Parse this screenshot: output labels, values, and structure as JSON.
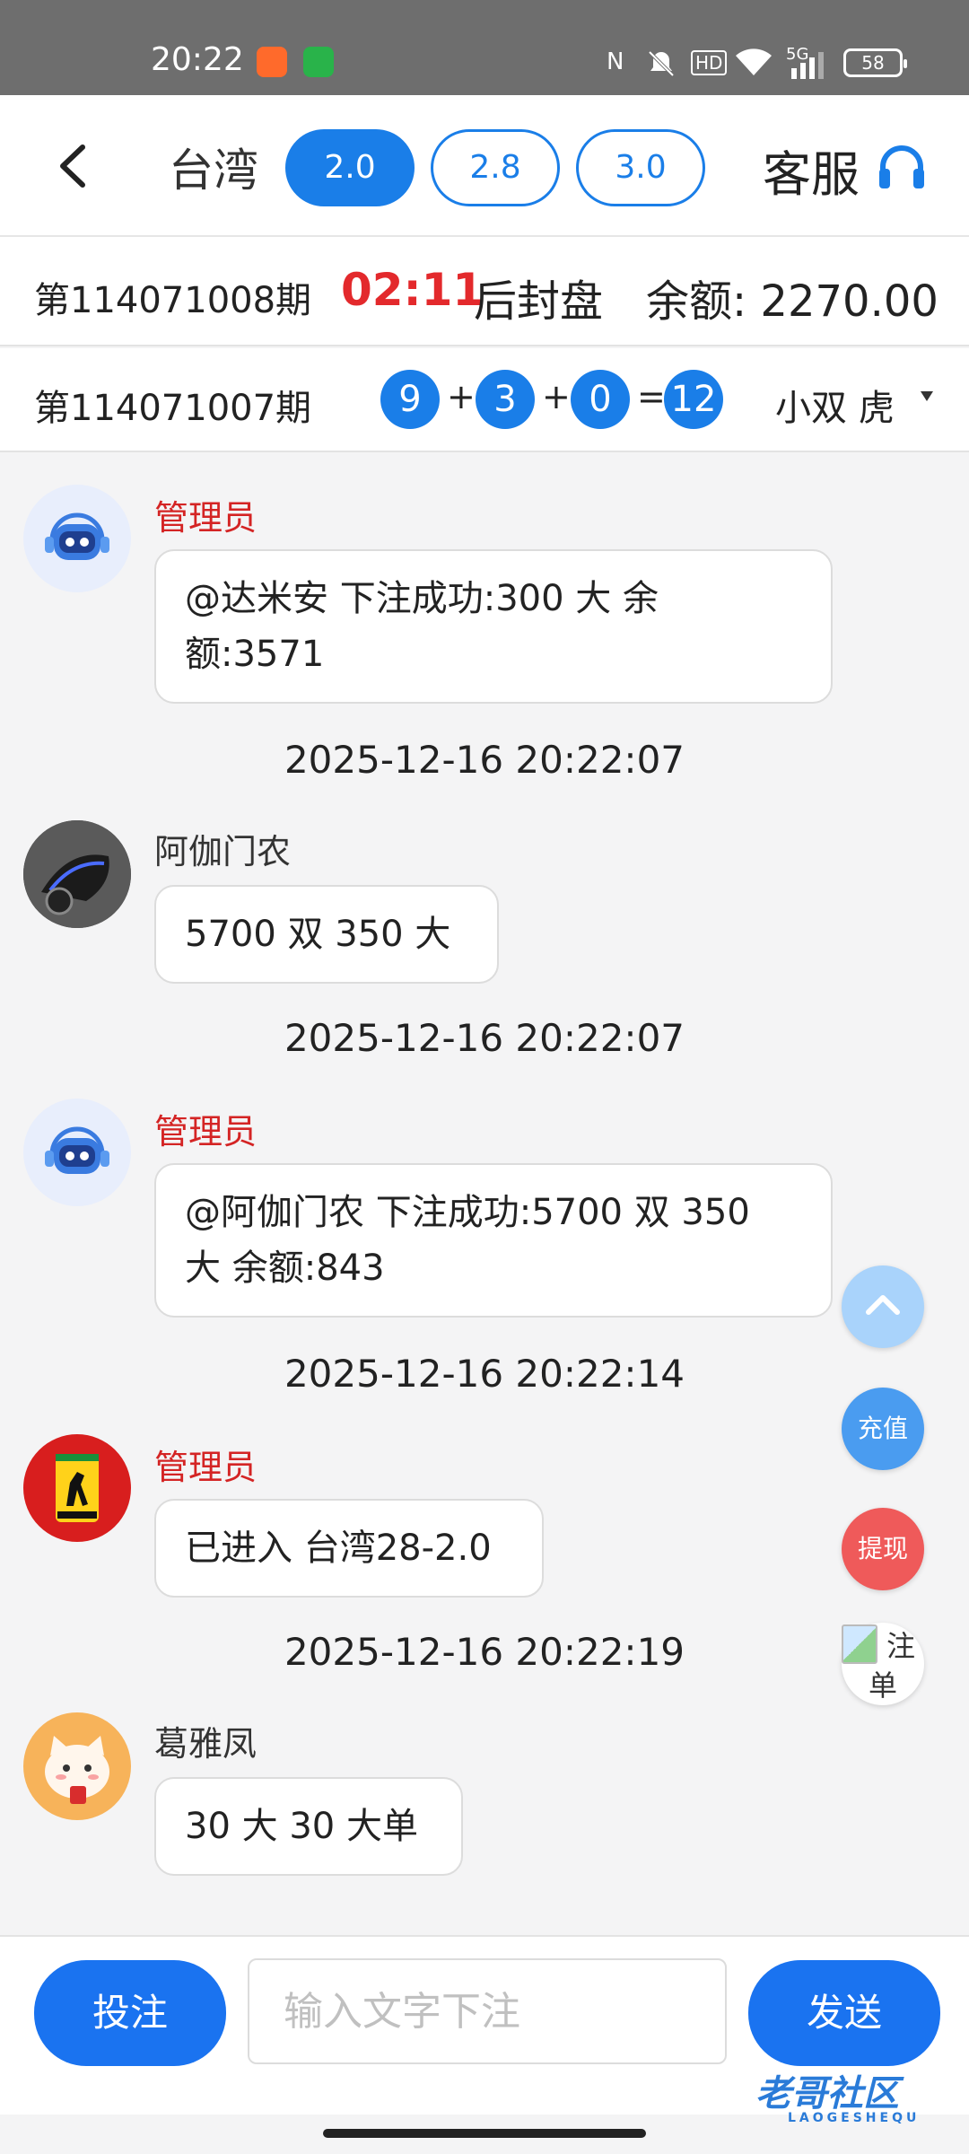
{
  "status_bar": {
    "time": "20:22",
    "battery": "58",
    "network": "5G",
    "hd": "HD"
  },
  "header": {
    "region": "台湾",
    "odds_tabs": [
      {
        "label": "2.0",
        "active": true
      },
      {
        "label": "2.8",
        "active": false
      },
      {
        "label": "3.0",
        "active": false
      }
    ],
    "service_label": "客服"
  },
  "current_period": {
    "label": "第114071008期",
    "countdown": "02:11",
    "seal_text": "后封盘",
    "balance": "余额: 2270.00"
  },
  "last_period": {
    "label": "第114071007期",
    "balls": [
      "9",
      "3",
      "0",
      "12"
    ],
    "ops": [
      "+",
      "+",
      "="
    ],
    "result": "小双 虎"
  },
  "messages": [
    {
      "sender": "管理员",
      "role": "admin",
      "avatar": "robot-avatar",
      "text": "@达米安 下注成功:300 大 余\n额:3571"
    },
    {
      "timestamp": "2025-12-16 20:22:07"
    },
    {
      "sender": "阿伽门农",
      "role": "user",
      "avatar": "motorcycle-avatar",
      "text": "5700 双 350 大"
    },
    {
      "timestamp": "2025-12-16 20:22:07"
    },
    {
      "sender": "管理员",
      "role": "admin",
      "avatar": "robot-avatar",
      "text": "@阿伽门农 下注成功:5700 双 350\n大 余额:843"
    },
    {
      "timestamp": "2025-12-16 20:22:14"
    },
    {
      "sender": "管理员",
      "role": "admin",
      "avatar": "ferrari-avatar",
      "text": "已进入 台湾28-2.0"
    },
    {
      "timestamp": "2025-12-16 20:22:19"
    },
    {
      "sender": "葛雅凤",
      "role": "user",
      "avatar": "cat-avatar",
      "text": "30 大 30 大单"
    }
  ],
  "floating": {
    "recharge": "充值",
    "withdraw": "提现",
    "orders_line1": "注",
    "orders_line2": "单"
  },
  "bottom_bar": {
    "bet_label": "投注",
    "input_placeholder": "输入文字下注",
    "send_label": "发送"
  },
  "watermark": {
    "text": "老哥社区",
    "subtext": "LAOGESHEQU"
  },
  "colors": {
    "accent": "#1a7ee8",
    "admin_name": "#d42424",
    "countdown": "#e3292c",
    "withdraw": "#ef5a5a"
  }
}
